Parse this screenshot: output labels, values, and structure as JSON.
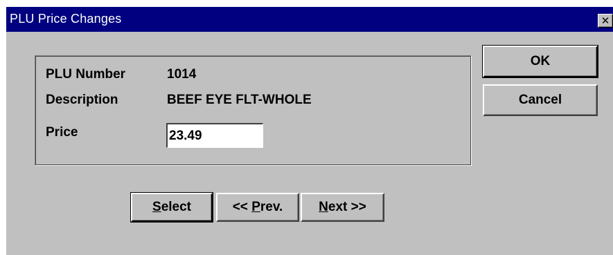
{
  "window": {
    "title": "PLU Price Changes",
    "close_glyph": "✕"
  },
  "fields": {
    "plu_number_label": "PLU Number",
    "plu_number_value": "1014",
    "description_label": "Description",
    "description_value": "BEEF EYE FLT-WHOLE",
    "price_label": "Price",
    "price_value": "23.49"
  },
  "buttons": {
    "ok": "OK",
    "cancel": "Cancel",
    "select_mnemonic": "S",
    "select_rest": "elect",
    "prev_prefix": "<< ",
    "prev_mnemonic": "P",
    "prev_rest": "rev.",
    "next_mnemonic": "N",
    "next_rest": "ext >>"
  },
  "colors": {
    "title_bar": "#000080",
    "dialog_face": "#c0c0c0"
  }
}
